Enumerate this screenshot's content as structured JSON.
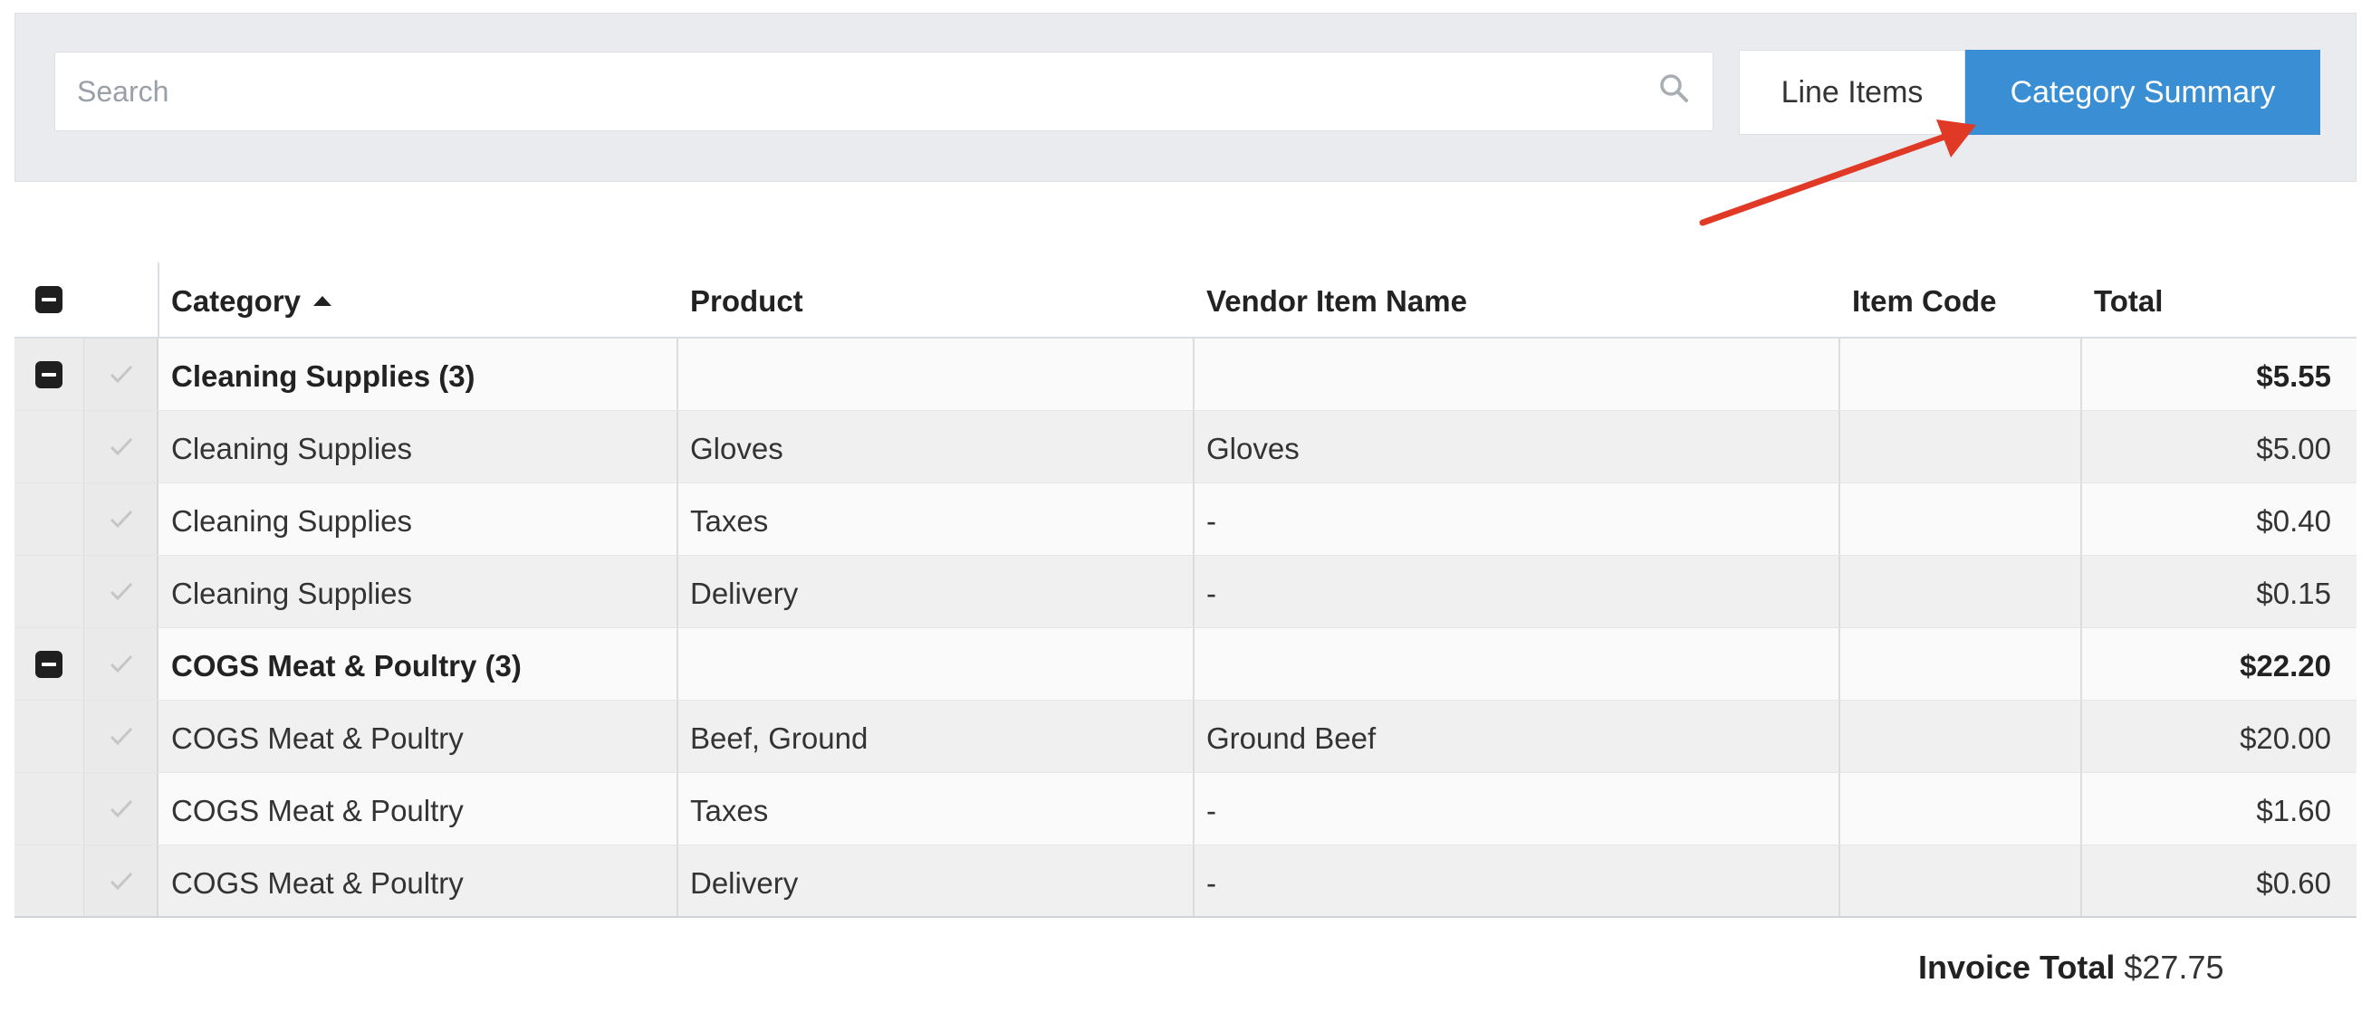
{
  "search": {
    "placeholder": "Search"
  },
  "view_toggle": {
    "line_items_label": "Line Items",
    "category_summary_label": "Category Summary",
    "active": "Category Summary"
  },
  "colors": {
    "accent": "#3a8fd4",
    "annotation_arrow": "#e03a26",
    "toolbar_bg": "#e9ebef"
  },
  "table": {
    "headers": {
      "category": "Category",
      "product": "Product",
      "vendor_item_name": "Vendor Item Name",
      "item_code": "Item Code",
      "total": "Total"
    },
    "sort": {
      "column": "Category",
      "direction": "ascending"
    },
    "rows": [
      {
        "type": "group",
        "category": "Cleaning Supplies (3)",
        "product": "",
        "vendor": "",
        "item_code": "",
        "total": "$5.55"
      },
      {
        "type": "item",
        "category": "Cleaning Supplies",
        "product": "Gloves",
        "vendor": "Gloves",
        "item_code": "",
        "total": "$5.00"
      },
      {
        "type": "item",
        "category": "Cleaning Supplies",
        "product": "Taxes",
        "vendor": "-",
        "item_code": "",
        "total": "$0.40"
      },
      {
        "type": "item",
        "category": "Cleaning Supplies",
        "product": "Delivery",
        "vendor": "-",
        "item_code": "",
        "total": "$0.15"
      },
      {
        "type": "group",
        "category": "COGS Meat & Poultry (3)",
        "product": "",
        "vendor": "",
        "item_code": "",
        "total": "$22.20"
      },
      {
        "type": "item",
        "category": "COGS Meat & Poultry",
        "product": "Beef, Ground",
        "vendor": "Ground Beef",
        "item_code": "",
        "total": "$20.00"
      },
      {
        "type": "item",
        "category": "COGS Meat & Poultry",
        "product": "Taxes",
        "vendor": "-",
        "item_code": "",
        "total": "$1.60"
      },
      {
        "type": "item",
        "category": "COGS Meat & Poultry",
        "product": "Delivery",
        "vendor": "-",
        "item_code": "",
        "total": "$0.60"
      }
    ]
  },
  "invoice_total": {
    "label": "Invoice Total",
    "value": "$27.75"
  }
}
